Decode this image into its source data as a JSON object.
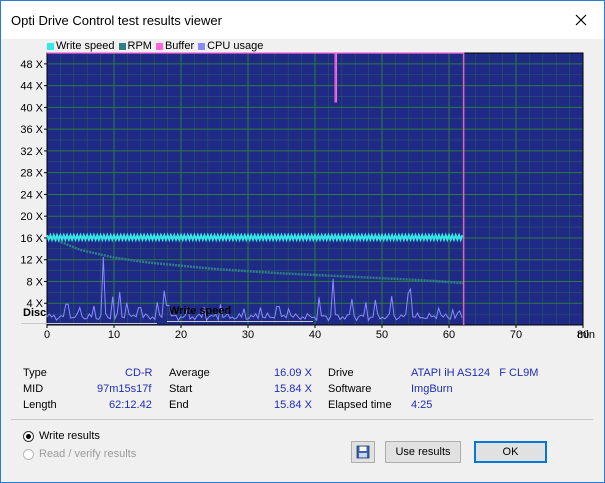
{
  "window": {
    "title": "Opti Drive Control test results viewer"
  },
  "colors": {
    "write_speed": "#34e8e8",
    "rpm": "#2f7f86",
    "buffer": "#ff66dd",
    "cpu": "#8a8aff",
    "plot_bg": "#1f2a86",
    "grid": "#2f7a3f"
  },
  "chart_data": {
    "type": "line",
    "legend": [
      "Write speed",
      "RPM",
      "Buffer",
      "CPU usage"
    ],
    "x_unit": "min",
    "xlim": [
      0,
      80
    ],
    "ylim": [
      0,
      50
    ],
    "x_ticks": [
      0,
      10,
      20,
      30,
      40,
      50,
      60,
      70,
      80
    ],
    "y_ticks": [
      4,
      8,
      12,
      16,
      20,
      24,
      28,
      32,
      36,
      40,
      44,
      48
    ],
    "y_tick_suffix": " X",
    "write_speed": {
      "x": [
        0,
        62.2
      ],
      "y": [
        16.1,
        16.1
      ],
      "jitter": 0.4
    },
    "rpm": {
      "x": [
        0,
        5,
        10,
        15,
        20,
        25,
        30,
        35,
        40,
        45,
        50,
        55,
        60,
        62.2
      ],
      "y": [
        16.3,
        13.8,
        12.4,
        11.5,
        10.9,
        10.3,
        9.9,
        9.5,
        9.2,
        8.9,
        8.6,
        8.3,
        7.9,
        7.7
      ]
    },
    "buffer": {
      "x": [
        0,
        43,
        43,
        43.2,
        43.2,
        62.2,
        62.2
      ],
      "y": [
        50,
        50,
        41,
        41,
        50,
        50,
        0
      ]
    },
    "cpu": {
      "baseline": 1.5,
      "spikes": [
        [
          3,
          3.8
        ],
        [
          5,
          3.2
        ],
        [
          7,
          3.5
        ],
        [
          8.5,
          12.5
        ],
        [
          9.8,
          5.2
        ],
        [
          10.8,
          6.1
        ],
        [
          12,
          4.1
        ],
        [
          13.8,
          3.2
        ],
        [
          16.5,
          4.2
        ],
        [
          17.5,
          6.3
        ],
        [
          18,
          3.6
        ],
        [
          21,
          3.1
        ],
        [
          23.5,
          3.3
        ],
        [
          26,
          3.8
        ],
        [
          29.5,
          3
        ],
        [
          32,
          3.2
        ],
        [
          34.5,
          3.4
        ],
        [
          36,
          3
        ],
        [
          40.5,
          5.1
        ],
        [
          42.8,
          8.5
        ],
        [
          45.5,
          4.8
        ],
        [
          47.5,
          4.2
        ],
        [
          49,
          4.6
        ],
        [
          51.5,
          5.3
        ],
        [
          53.8,
          5.8
        ],
        [
          54.3,
          6.6
        ],
        [
          58.5,
          3.1
        ],
        [
          60.5,
          2.8
        ],
        [
          61.5,
          2.6
        ]
      ]
    }
  },
  "disc": {
    "header": "Disc",
    "type_label": "Type",
    "type_value": "CD-R",
    "mid_label": "MID",
    "mid_value": "97m15s17f",
    "length_label": "Length",
    "length_value": "62:12.42"
  },
  "write_speed": {
    "header": "Write speed",
    "average_label": "Average",
    "average_value": "16.09 X",
    "start_label": "Start",
    "start_value": "15.84 X",
    "end_label": "End",
    "end_value": "15.84 X"
  },
  "drive": {
    "drive_label": "Drive",
    "drive_value": "ATAPI iH AS124   F CL9M",
    "software_label": "Software",
    "software_value": "ImgBurn",
    "elapsed_label": "Elapsed time",
    "elapsed_value": "4:25"
  },
  "options": {
    "write_results": "Write results",
    "read_verify": "Read / verify results"
  },
  "buttons": {
    "use_results": "Use results",
    "ok": "OK"
  }
}
